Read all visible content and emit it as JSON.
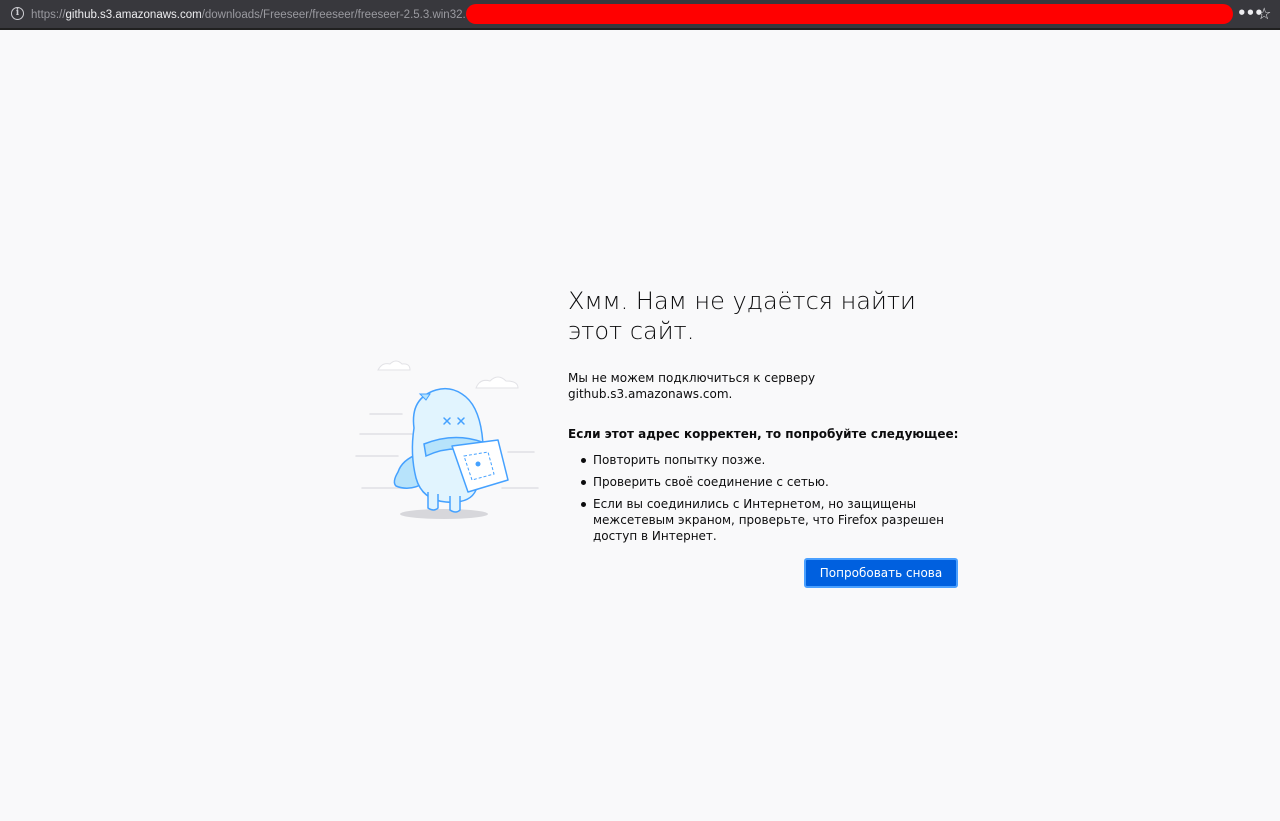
{
  "urlbar": {
    "protocol": "https://",
    "host": "github.s3.amazonaws.com",
    "path": "/downloads/Freeseer/freeseer/freeseer-2.5.3.win32.exe",
    "info_icon": "info-icon",
    "more_icon": "ellipsis-icon",
    "bookmark_icon": "star-icon",
    "redaction_color": "#ff0000"
  },
  "error": {
    "title": "Хмм. Нам не удаётся найти этот сайт.",
    "description": "Мы не можем подключиться к серверу github.s3.amazonaws.com.",
    "subheading": "Если этот адрес корректен, то попробуйте следующее:",
    "suggestions": [
      "Повторить попытку позже.",
      "Проверить своё соединение с сетью.",
      "Если вы соединились с Интернетом, но защищены межсетевым экраном, проверьте, что Firefox разрешен доступ в Интернет."
    ],
    "retry_label": "Попробовать снова",
    "accent_color": "#0060df"
  }
}
